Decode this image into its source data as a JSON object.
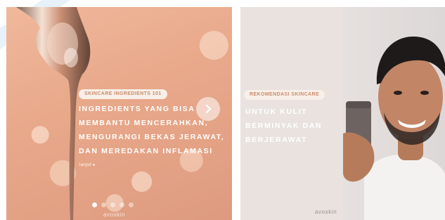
{
  "slides": [
    {
      "badge": "SKINCARE INGREDIENTS 101",
      "headline_lines": [
        "INGREDIENTS YANG BISA",
        "MEMBANTU MENCERAHKAN,",
        "MENGURANGI BEKAS JERAWAT,",
        "DAN MEREDAKAN INFLAMASI"
      ],
      "link_text": "lanjut ▸",
      "brand": "avoskin",
      "image_subject": "serum-drip"
    },
    {
      "badge": "REKOMENDASI SKINCARE",
      "headline_lines": [
        "UNTUK KULIT",
        "BERMINYAK DAN",
        "BERJERAWAT"
      ],
      "brand": "avoskin",
      "image_subject": "man-holding-product"
    }
  ],
  "carousel": {
    "dot_count": 5,
    "active_dot": 1,
    "next_icon": "chevron-right-icon"
  },
  "colors": {
    "peach_bg": "#e9a98b",
    "badge_bg": "#f7efe8",
    "badge_text": "#c98c6c",
    "right_bg": "#e9e2df"
  }
}
